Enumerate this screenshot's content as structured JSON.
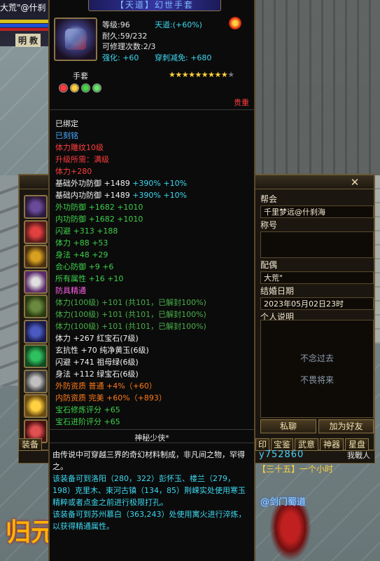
{
  "hud": {
    "player_name": "大荒\"@什刹",
    "sect": "明 教"
  },
  "tooltip": {
    "title": "【天道】幻世手套",
    "level": "等级:96",
    "durability": "耐久:59/232",
    "repairs": "可修理次数:2/3",
    "enhance": "强化: +60",
    "tiandao": "天道:(+60%)",
    "pierce_reduce": "穿刺减免: +680",
    "item_type": "手套",
    "stars_full": "★★★★★★★★★",
    "stars_empty": "★",
    "rarity": "贵重",
    "attributes": [
      {
        "text": "已绑定",
        "color": "white"
      },
      {
        "text": "已刻铭",
        "color": "blue"
      },
      {
        "text": "体力雕纹10级",
        "color": "red"
      },
      {
        "text": "升级所需：满级",
        "color": "red"
      },
      {
        "text": "体力+280",
        "color": "red"
      },
      {
        "text": "基础外功防御 +1489 +390% +10%",
        "color": "white",
        "extra": "+390% +10%"
      },
      {
        "text": "基础内功防御 +1489 +390% +10%",
        "color": "white",
        "extra": "+390% +10%"
      },
      {
        "text": "外功防御 +1682 +1010",
        "color": "green"
      },
      {
        "text": "内功防御 +1682 +1010",
        "color": "green"
      },
      {
        "text": "闪避 +313 +188",
        "color": "green"
      },
      {
        "text": "体力 +88 +53",
        "color": "green"
      },
      {
        "text": "身法 +48 +29",
        "color": "green"
      },
      {
        "text": "会心防御 +9 +6",
        "color": "green"
      },
      {
        "text": "所有属性 +16 +10",
        "color": "green"
      },
      {
        "text": "防具精通",
        "color": "pink"
      },
      {
        "text": "体力(100级) +101 (共101，已解封100%)",
        "color": "lgreen"
      },
      {
        "text": "体力(100级) +101 (共101，已解封100%)",
        "color": "lgreen"
      },
      {
        "text": "体力(100级) +101 (共101，已解封100%)",
        "color": "lgreen"
      },
      {
        "text": "体力 +267 红宝石(7级)",
        "color": "white"
      },
      {
        "text": "玄抗性 +70 纯净黄玉(6级)",
        "color": "white"
      },
      {
        "text": "闪避 +741 祖母绿(6级)",
        "color": "white"
      },
      {
        "text": "身法 +112 绿宝石(6级)",
        "color": "white"
      },
      {
        "text": "外防资质 普通 +4%（+60）",
        "color": "orange"
      },
      {
        "text": "内防资质 完美 +60%（+893）",
        "color": "orange"
      },
      {
        "text": "宝石修炼评分 +65",
        "color": "green"
      },
      {
        "text": "宝石进阶评分 +65",
        "color": "green"
      }
    ],
    "author": "神秘少侠*",
    "lore": [
      {
        "text": "由传说中可穿越三界的奇幻材料制成，非凡间之物，罕得之。",
        "color": "white"
      },
      {
        "text": "该装备可到洛阳（280，322）彭怀玉、楼兰（279，198）克里木、束河古镇（134，85）荆嵘实处使用寒玉精粹或者点金之前进行极限打孔。",
        "color": "cyan"
      },
      {
        "text": "该装备可到苏州慕白（363,243）处使用寓火进行淬炼，以获得精通属性。",
        "color": "cyan"
      }
    ]
  },
  "character": {
    "guild_label": "帮会",
    "guild_value": "千里梦远@什刹海",
    "title_label": "称号",
    "title_value": "",
    "spouse_label": "配偶",
    "spouse_value": "大荒\"",
    "wedding_label": "结婚日期",
    "wedding_value": "2023年05月02日23时",
    "bio_label": "个人说明",
    "bio_line1": "不念过去",
    "bio_line2": "不畏将来",
    "btn_chat": "私聊",
    "btn_friend": "加为好友",
    "close": "✕",
    "tabs": [
      "装备",
      "印",
      "宝鉴",
      "武意",
      "神器",
      "星盘"
    ]
  },
  "scene": {
    "deco": "归元",
    "chat_number": "y752860",
    "chat_line": "【三十五】一个小时",
    "chat_right": "我戰人",
    "blue_name": "@剑门蜀道"
  },
  "colors": {
    "title_blue": "#7fb8ff",
    "attr_green": "#3dd04a",
    "attr_red": "#ff3c3c",
    "attr_cyan": "#3dd8f0",
    "attr_pink": "#ff60e8",
    "attr_orange": "#ff7a1a"
  }
}
